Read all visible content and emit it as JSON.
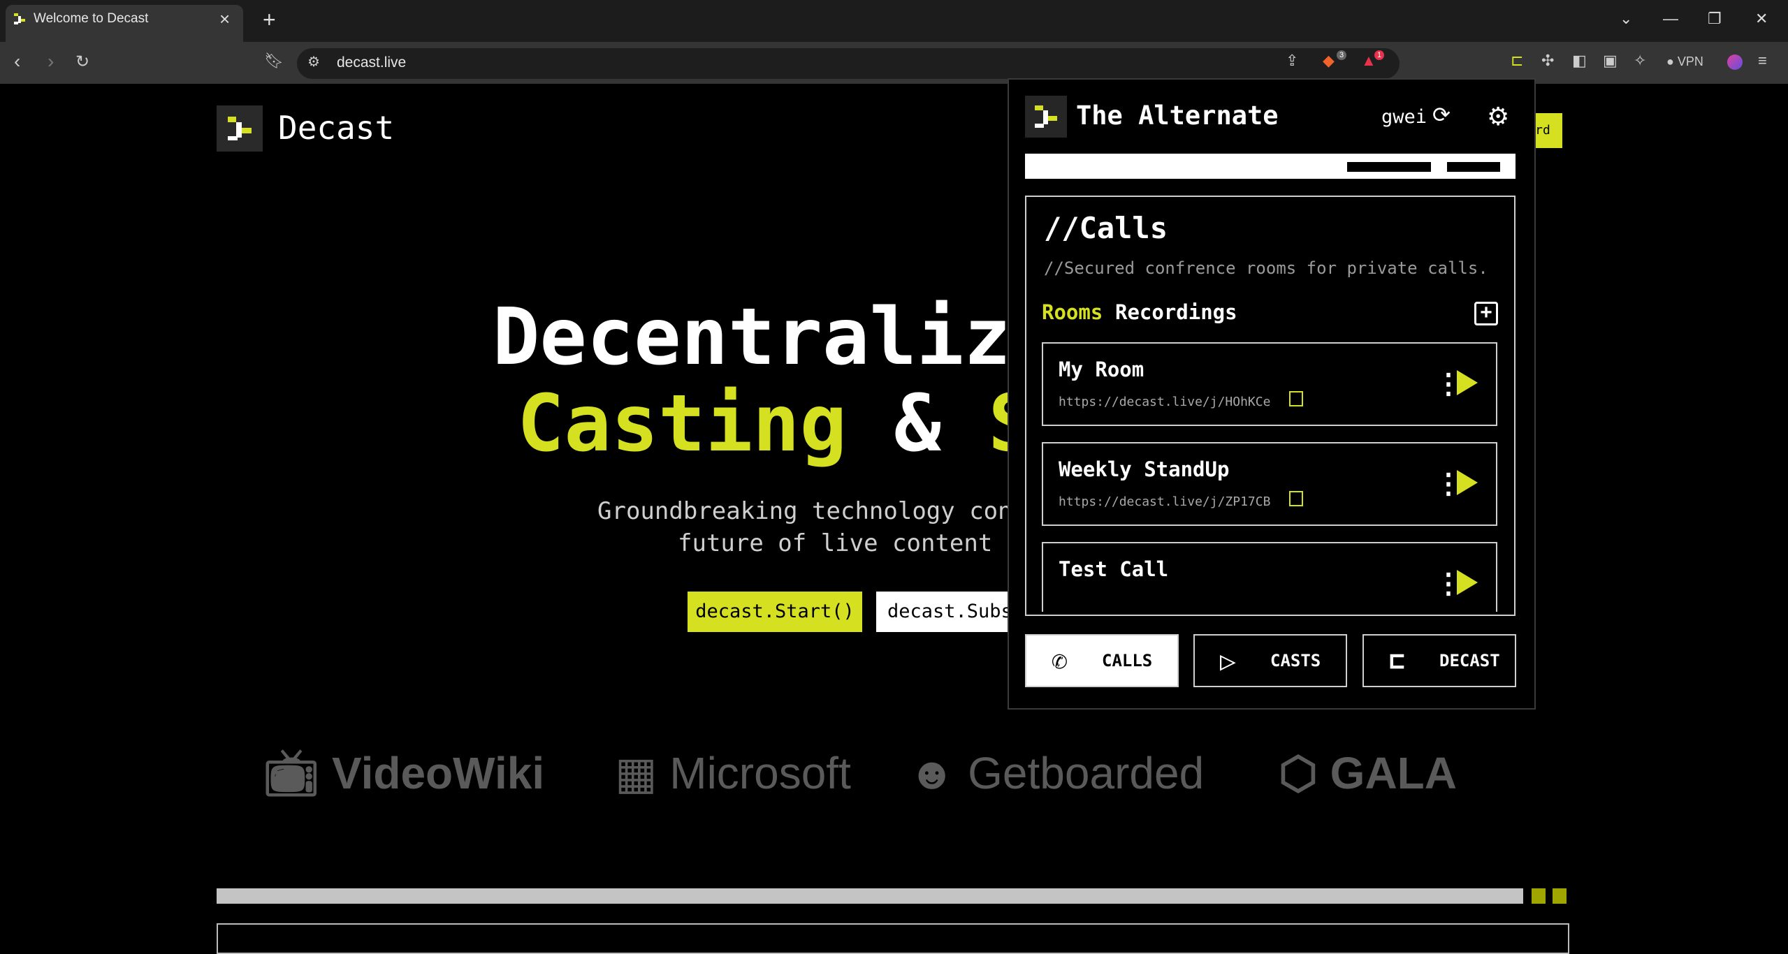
{
  "browser": {
    "tab_title": "Welcome to Decast",
    "tab_close": "×",
    "new_tab": "+",
    "url": "decast.live",
    "vpn_label": "VPN",
    "brave_badge": "3",
    "alert_badge": "1"
  },
  "page": {
    "logo_text": "Decast",
    "hero_line1": "Decentralize",
    "hero_line2_a": "Casting",
    "hero_line2_amp": "&",
    "hero_line2_b": "S",
    "subtitle_line1": "Groundbreaking technology conve",
    "subtitle_line2": "future of live content cr",
    "start_button": "decast.Start()",
    "subscribe_button": "decast.Subs",
    "corner_button_fragment": "rd",
    "partners": [
      "VideoWiki",
      "Microsoft",
      "Getboarded",
      "GALA"
    ]
  },
  "popup": {
    "title": "The Alternate",
    "gwei_label": "gwei",
    "calls_title": "//Calls",
    "calls_subtitle": "//Secured confrence rooms for private calls.",
    "tabs": {
      "rooms": "Rooms",
      "recordings": "Recordings"
    },
    "rooms": [
      {
        "name": "My Room",
        "url": "https://decast.live/j/HOhKCe"
      },
      {
        "name": "Weekly StandUp",
        "url": "https://decast.live/j/ZP17CB"
      },
      {
        "name": "Test Call",
        "url": ""
      }
    ],
    "nav": {
      "calls": "CALLS",
      "casts": "CASTS",
      "decast": "DECAST"
    }
  },
  "colors": {
    "accent": "#d4e020",
    "background": "#000000",
    "chrome": "#353535"
  },
  "icons": [
    "decast-logo-icon",
    "refresh-icon",
    "settings-icon",
    "add-icon",
    "copy-icon",
    "more-icon",
    "play-icon",
    "phone-icon",
    "broadcast-icon"
  ]
}
